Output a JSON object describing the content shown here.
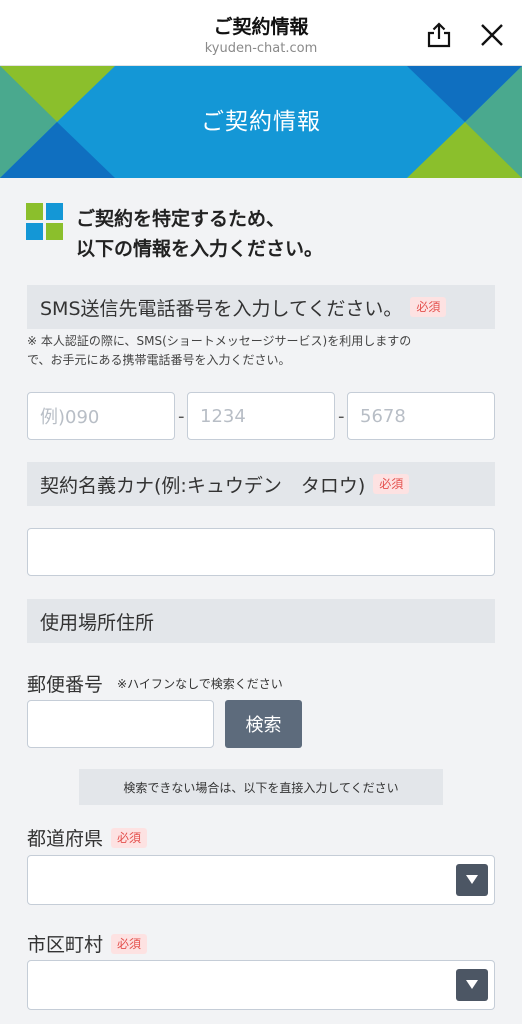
{
  "nav": {
    "title": "ご契約情報",
    "url": "kyuden-chat.com",
    "share_icon": "share-icon",
    "close_icon": "close-icon"
  },
  "banner": {
    "title": "ご契約情報",
    "colors": {
      "blue": "#1497d6",
      "green": "#8bbf2c",
      "teal": "#4aa98e",
      "dark_blue": "#0f6fc0"
    }
  },
  "intro": {
    "icon": "grid-icon",
    "line1": "ご契約を特定するため、",
    "line2": "以下の情報を入力ください。"
  },
  "required_label": "必須",
  "sms": {
    "heading": "SMS送信先電話番号を入力してください。",
    "note_line1": "※ 本人認証の際に、SMS(ショートメッセージサービス)を利用しますの",
    "note_line2": "で、お手元にある携帯電話番号を入力ください。",
    "placeholder1": "例)090",
    "placeholder2": "1234",
    "placeholder3": "5678",
    "separator": "-"
  },
  "kana": {
    "heading": "契約名義カナ(例:キュウデン　タロウ)"
  },
  "address": {
    "heading": "使用場所住所",
    "postal_label": "郵便番号",
    "postal_note": "※ハイフンなしで検索ください",
    "search_button": "検索",
    "search_note": "検索できない場合は、以下を直接入力してください",
    "prefecture_label": "都道府県",
    "city_label": "市区町村"
  }
}
